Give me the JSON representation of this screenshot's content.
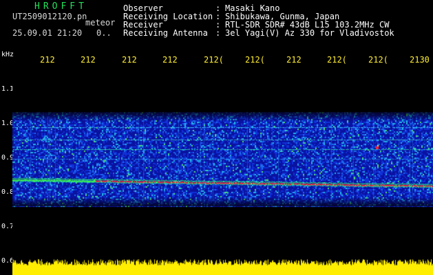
{
  "header": {
    "logo": "HROFFT",
    "filename": "UT2509012120.pn",
    "mode": "meteor",
    "datetime": "25.09.01 21:20",
    "status": "0..",
    "info": [
      {
        "label": "Observer",
        "value": "Masaki Kano"
      },
      {
        "label": "Receiving Location",
        "value": "Shibukawa, Gunma, Japan"
      },
      {
        "label": "Receiver",
        "value": "RTL-SDR SDR# 43dB L15 103.2MHz CW"
      },
      {
        "label": "Receiving Antenna",
        "value": "3el Yagi(V) Az 330 for Vladivostok"
      }
    ],
    "separator": ":"
  },
  "axis": {
    "unit": "kHz",
    "time_ticks": [
      "212",
      "212",
      "212",
      "212",
      "212(",
      "212(",
      "212",
      "212(",
      "212(",
      "2130"
    ],
    "freq_ticks": [
      "1.1",
      "1.0",
      "0.9",
      "0.8",
      "0.7",
      "0.6"
    ]
  },
  "colors": {
    "background": "#000000",
    "header_text": "#ffffff",
    "logo": "#22e05a",
    "ticks": "#ffee33",
    "noise": "#1020c0",
    "carrier": "#ff2030",
    "strip": "#ffee00"
  }
}
